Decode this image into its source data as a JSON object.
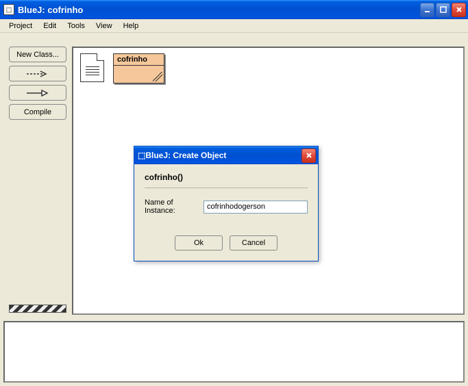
{
  "window": {
    "title": "BlueJ:  cofrinho"
  },
  "menu": {
    "project": "Project",
    "edit": "Edit",
    "tools": "Tools",
    "view": "View",
    "help": "Help"
  },
  "sidebar": {
    "newclass": "New Class...",
    "compile": "Compile"
  },
  "canvas": {
    "classname": "cofrinho"
  },
  "dialog": {
    "title": "BlueJ:  Create Object",
    "constructor": "cofrinho()",
    "instance_label": "Name of Instance:",
    "instance_value": "cofrinhodogerson",
    "ok": "Ok",
    "cancel": "Cancel"
  }
}
